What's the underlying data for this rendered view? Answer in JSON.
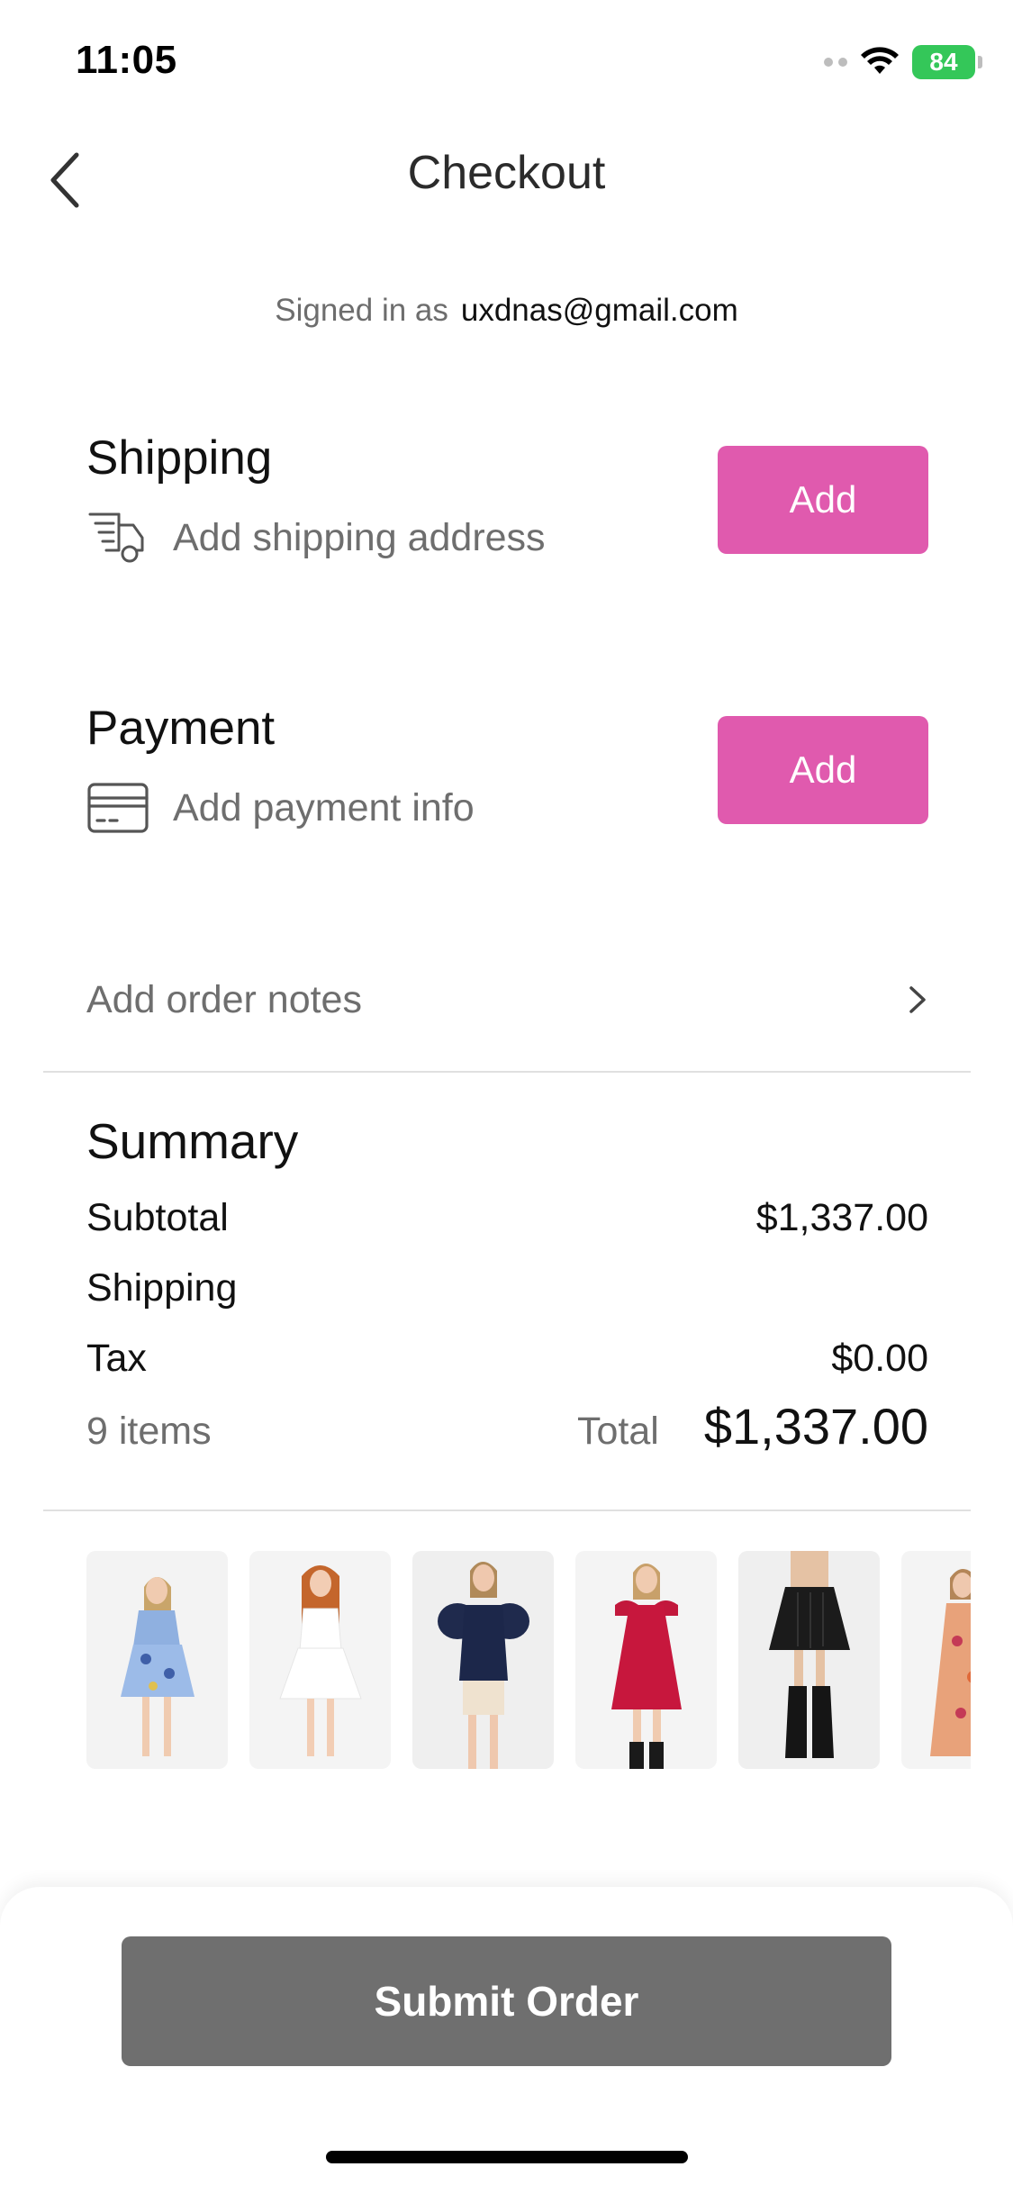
{
  "status_bar": {
    "time": "11:05",
    "battery": "84"
  },
  "nav": {
    "title": "Checkout"
  },
  "account": {
    "label": "Signed in as",
    "email": "uxdnas@gmail.com"
  },
  "shipping": {
    "title": "Shipping",
    "subtitle": "Add shipping address",
    "button_label": "Add"
  },
  "payment": {
    "title": "Payment",
    "subtitle": "Add payment info",
    "button_label": "Add"
  },
  "order_notes": {
    "label": "Add order notes"
  },
  "summary": {
    "title": "Summary",
    "rows": [
      {
        "label": "Subtotal",
        "value": "$1,337.00"
      },
      {
        "label": "Shipping",
        "value": ""
      },
      {
        "label": "Tax",
        "value": "$0.00"
      }
    ],
    "items_count": "9 items",
    "total_label": "Total",
    "total_value": "$1,337.00"
  },
  "cart_thumbnails": [
    {
      "icon": "blue-floral-dress-thumbnail"
    },
    {
      "icon": "white-dress-thumbnail"
    },
    {
      "icon": "navy-top-thumbnail"
    },
    {
      "icon": "red-ruffle-dress-thumbnail"
    },
    {
      "icon": "black-leather-skirt-thumbnail"
    },
    {
      "icon": "floral-maxi-dress-thumbnail"
    }
  ],
  "footer": {
    "submit_label": "Submit Order"
  },
  "colors": {
    "accent": "#e05aae",
    "submit": "#6f6f6f",
    "battery": "#34c759"
  }
}
